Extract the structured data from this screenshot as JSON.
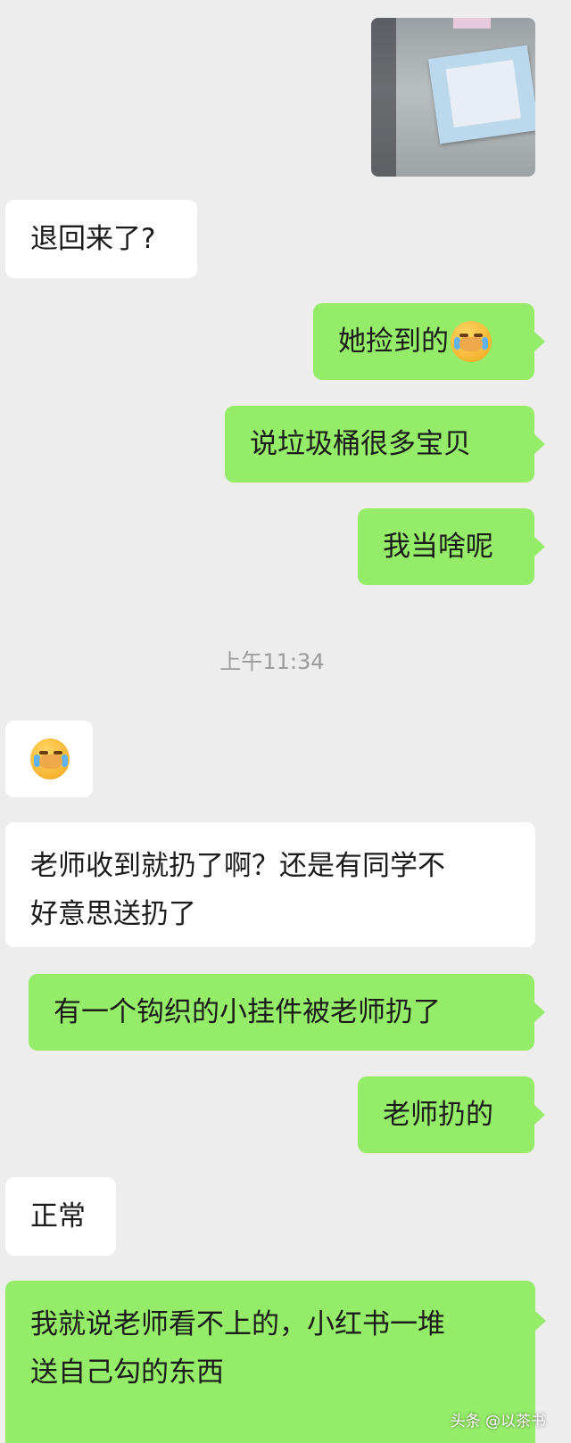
{
  "messages": [
    {
      "side": "in",
      "text": "退回来了?"
    },
    {
      "side": "out",
      "text": "她捡到的",
      "emoji": "facepalm-crying-emoji"
    },
    {
      "side": "out",
      "text": "说垃圾桶很多宝贝"
    },
    {
      "side": "out",
      "text": "我当啥呢"
    },
    {
      "side": "in",
      "emoji": "facepalm-crying-emoji"
    },
    {
      "side": "in",
      "lines": [
        "老师收到就扔了啊？还是有同学不",
        "好意思送扔了"
      ]
    },
    {
      "side": "out",
      "text": "有一个钩织的小挂件被老师扔了"
    },
    {
      "side": "out",
      "text": "老师扔的"
    },
    {
      "side": "in",
      "text": "正常"
    },
    {
      "side": "out",
      "lines": [
        "我就说老师看不上的，小红书一堆",
        "送自己勾的东西"
      ]
    }
  ],
  "timestamp": "上午11:34",
  "watermark": "头条 @以茶书",
  "colors": {
    "background": "#ededed",
    "incoming": "#ffffff",
    "outgoing": "#95ec69",
    "timestamp": "#9b9b9b"
  }
}
